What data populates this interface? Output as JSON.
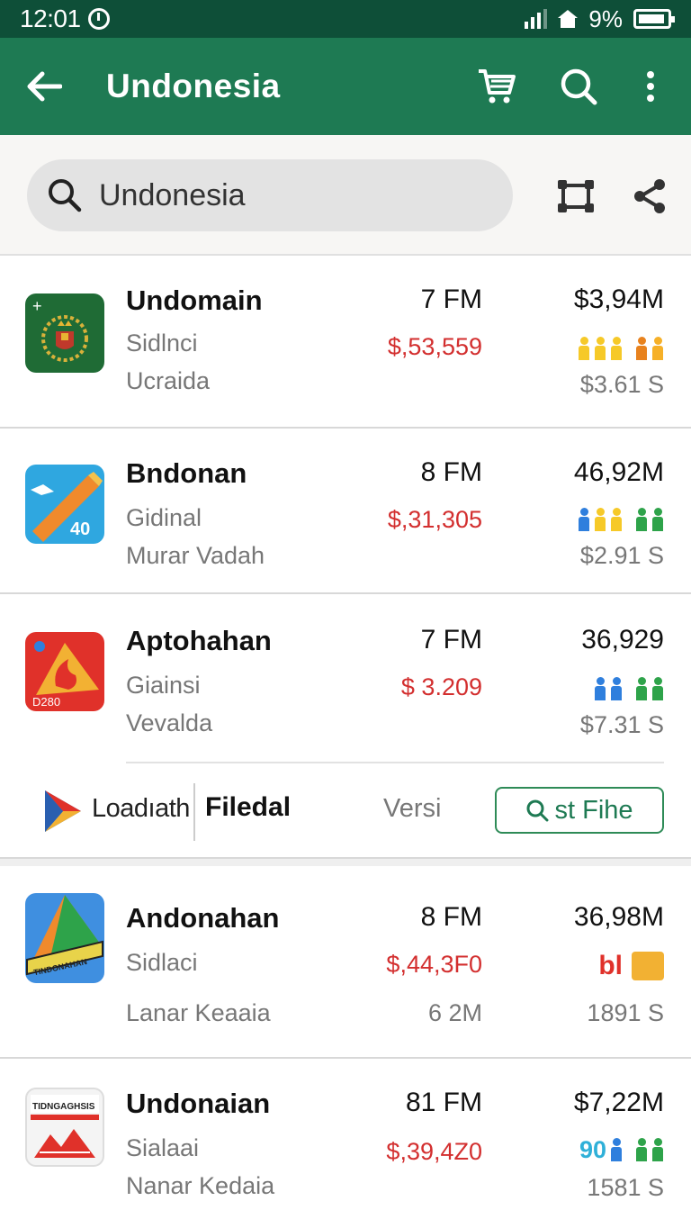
{
  "status_bar": {
    "time": "12:01",
    "battery": "9%"
  },
  "app_bar": {
    "title": "Undonesia",
    "back_icon": "arrow-left-icon",
    "cart_icon": "cart-icon",
    "search_icon": "search-icon",
    "menu_icon": "more-vert-icon"
  },
  "search": {
    "value": "Undonesia",
    "icon": "search-icon",
    "compare_icon": "compare-icon",
    "share_icon": "share-icon"
  },
  "colors": {
    "status_bar": "#0e4f38",
    "app_bar": "#1e7a53",
    "price_red": "#d32f2f",
    "accent_green": "#2e8b57"
  },
  "items": [
    {
      "name": "Undomain",
      "sub1": "Sidlnci",
      "sub2": "Ucraida",
      "mid_top": "7 FM",
      "mid_price": "$,53,559",
      "right_top": "$3,94M",
      "right_bottom": "$3.61 S",
      "icon": "green-emblem-app-icon"
    },
    {
      "name": "Bndonan",
      "sub1": "Gidinal",
      "sub2": "Murar Vadah",
      "mid_top": "8 FM",
      "mid_price": "$,31,305",
      "right_top": "46,92M",
      "right_bottom": "$2.91 S",
      "icon": "pencil-app-icon",
      "icon_text": "40"
    },
    {
      "name": "Aptohahan",
      "sub1": "Giainsi",
      "sub2": "Vevalda",
      "mid_top": "7 FM",
      "mid_price": "$  3.209",
      "right_top": "36,929",
      "right_bottom": "$7.31 S",
      "icon": "flame-app-icon",
      "icon_text": "D280"
    },
    {
      "name": "Andonahan",
      "sub1": "Sidlaci",
      "sub2": "Lanar Keaaia",
      "mid_top": "8 FM",
      "mid_price": "$,44,3F0",
      "mid_bottom": "6 2M",
      "right_top": "36,98M",
      "right_bottom": "1891 S",
      "badge_text": "bl",
      "icon": "triangle-app-icon",
      "icon_text": "TINDONAHAN"
    },
    {
      "name": "Undonaian",
      "sub1": "Sialaai",
      "sub2": "Nanar Kedaia",
      "mid_top": "81 FM",
      "mid_price": "$,39,4Z0",
      "right_top": "$7,22M",
      "right_bottom": "1581 S",
      "badge_text": "90",
      "icon": "box-app-icon",
      "icon_text": "TIDNGAGHSIS"
    }
  ],
  "promo": {
    "brand": "Loadıath",
    "title": "Filedal",
    "version": "Versi",
    "button_label": "st Fihe",
    "logo_icon": "play-logo-icon",
    "button_icon": "search-icon"
  }
}
